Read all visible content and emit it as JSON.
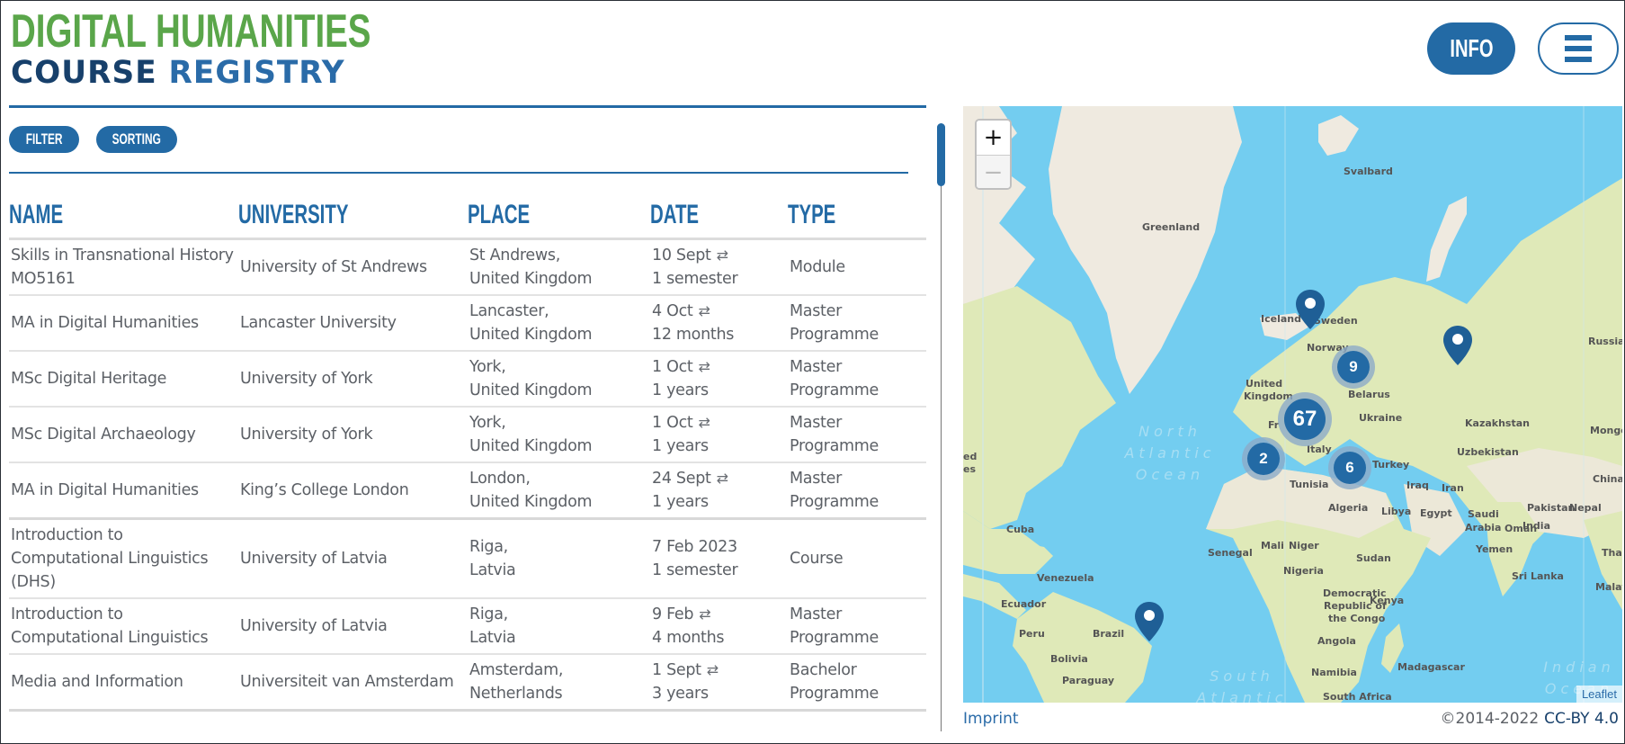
{
  "header": {
    "logo_line1": "DIGITAL HUMANITIES",
    "logo_line2_a": "COURSE",
    "logo_line2_b": "REGISTRY",
    "info_label": "INFO",
    "menu_icon": "hamburger-icon"
  },
  "toolbar": {
    "filter_label": "FILTER",
    "sorting_label": "SORTING"
  },
  "table": {
    "columns": [
      "NAME",
      "UNIVERSITY",
      "PLACE",
      "DATE",
      "TYPE"
    ],
    "rows": [
      {
        "name": "Skills in Transnational History MO5161",
        "university": "University of St Andrews",
        "city": "St Andrews,",
        "country": "United Kingdom",
        "date": "10 Sept",
        "recurring": true,
        "duration": "1 semester",
        "type": "Module"
      },
      {
        "name": "MA in Digital Humanities",
        "university": "Lancaster University",
        "city": "Lancaster,",
        "country": "United Kingdom",
        "date": "4 Oct",
        "recurring": true,
        "duration": "12 months",
        "type": "Master Programme"
      },
      {
        "name": "MSc Digital Heritage",
        "university": "University of York",
        "city": "York,",
        "country": "United Kingdom",
        "date": "1 Oct",
        "recurring": true,
        "duration": "1 years",
        "type": "Master Programme"
      },
      {
        "name": "MSc Digital Archaeology",
        "university": "University of York",
        "city": "York,",
        "country": "United Kingdom",
        "date": "1 Oct",
        "recurring": true,
        "duration": "1 years",
        "type": "Master Programme"
      },
      {
        "name": "MA in Digital Humanities",
        "university": "King’s College London",
        "city": "London,",
        "country": "United Kingdom",
        "date": "24 Sept",
        "recurring": true,
        "duration": "1 years",
        "type": "Master Programme"
      },
      {
        "name": "Introduction to Computational Linguistics (DHS)",
        "university": "University of Latvia",
        "city": "Riga,",
        "country": "Latvia",
        "date": "7 Feb 2023",
        "recurring": false,
        "duration": "1 semester",
        "type": "Course"
      },
      {
        "name": "Introduction to Computational Linguistics",
        "university": "University of Latvia",
        "city": "Riga,",
        "country": "Latvia",
        "date": "9 Feb",
        "recurring": true,
        "duration": "4 months",
        "type": "Master Programme"
      },
      {
        "name": "Media and Information",
        "university": "Universiteit van Amsterdam",
        "city": "Amsterdam,",
        "country": "Netherlands",
        "date": "1 Sept",
        "recurring": true,
        "duration": "3 years",
        "type": "Bachelor Programme"
      }
    ],
    "recurring_icon": "⇄"
  },
  "map": {
    "zoom_in": "+",
    "zoom_out": "−",
    "clusters": [
      {
        "count": "67"
      },
      {
        "count": "9"
      },
      {
        "count": "6"
      },
      {
        "count": "2"
      }
    ],
    "labels": {
      "greenland": "Greenland",
      "svalbard": "Svalbard",
      "iceland": "Iceland",
      "norway": "Norway",
      "sweden": "Sweden",
      "russia": "Russia",
      "uk1": "United",
      "uk2": "Kingdom",
      "belarus": "Belarus",
      "ukraine": "Ukraine",
      "kazakhstan": "Kazakhstan",
      "mongolia": "Mongo",
      "france": "Fr",
      "italy": "Italy",
      "turkey": "Turkey",
      "uzbekistan": "Uzbekistan",
      "china": "China",
      "tunisia": "Tunisia",
      "iraq": "Iraq",
      "iran": "Iran",
      "pakistan": "Pakistan",
      "nepal": "Nepal",
      "algeria": "Algeria",
      "libya": "Libya",
      "egypt": "Egypt",
      "saudi1": "Saudi",
      "saudi2": "Arabia",
      "oman": "Oman",
      "india": "India",
      "yemen": "Yemen",
      "thailand": "Thailand",
      "senegal": "Senegal",
      "mali": "Mali",
      "niger": "Niger",
      "sudan": "Sudan",
      "nigeria": "Nigeria",
      "srilanka": "Sri Lanka",
      "malaysia": "Malays",
      "drc1": "Democratic",
      "drc2": "Republic of",
      "drc3": "the Congo",
      "kenya": "Kenya",
      "cuba": "Cuba",
      "venezuela": "Venezuela",
      "ecuador": "Ecuador",
      "peru": "Peru",
      "brazil": "Brazil",
      "bolivia": "Bolivia",
      "paraguay": "Paraguay",
      "angola": "Angola",
      "namibia": "Namibia",
      "madagascar": "Madagascar",
      "southafrica": "South Africa",
      "us1": "ed",
      "us2": "es"
    },
    "oceans": {
      "north_atlantic": "North Atlantic Ocean",
      "south_atlantic": "South Atlantic",
      "indian": "Indian Ocean"
    },
    "attribution": "Leaflet"
  },
  "footer": {
    "imprint": "Imprint",
    "copyright": "©2014-2022",
    "license": "CC-BY 4.0"
  }
}
